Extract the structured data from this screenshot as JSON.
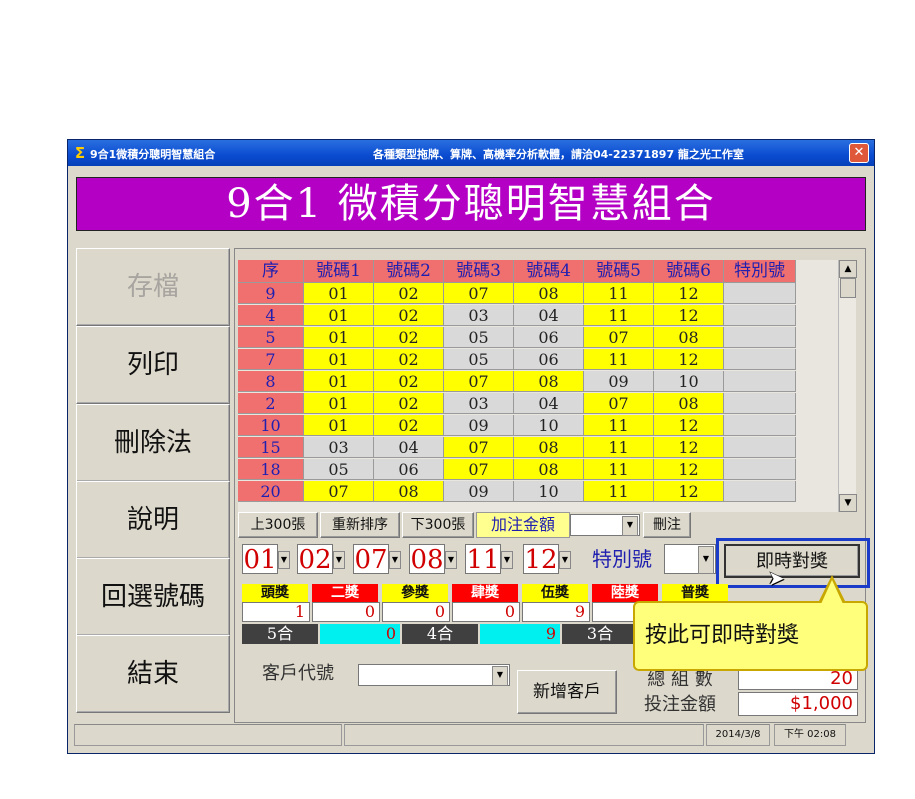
{
  "window": {
    "title": "9合1微積分聰明智慧組合",
    "subtitle": "各種類型拖牌、算牌、高機率分析軟體，請洽04-22371897 龍之光工作室",
    "close_icon": "close-icon",
    "app_icon": "sigma-icon"
  },
  "banner": "9合1 微積分聰明智慧組合",
  "sidebar": [
    {
      "label": "存檔",
      "disabled": true
    },
    {
      "label": "列印",
      "disabled": false
    },
    {
      "label": "刪除法",
      "disabled": false
    },
    {
      "label": "說明",
      "disabled": false
    },
    {
      "label": "回選號碼",
      "disabled": false
    },
    {
      "label": "結束",
      "disabled": false
    }
  ],
  "table": {
    "headers": [
      "序",
      "號碼1",
      "號碼2",
      "號碼3",
      "號碼4",
      "號碼5",
      "號碼6",
      "特別號"
    ],
    "rows": [
      {
        "idx": "9",
        "nums": [
          "01",
          "02",
          "07",
          "08",
          "11",
          "12"
        ],
        "hl": [
          1,
          1,
          1,
          1,
          1,
          1
        ]
      },
      {
        "idx": "4",
        "nums": [
          "01",
          "02",
          "03",
          "04",
          "11",
          "12"
        ],
        "hl": [
          1,
          1,
          0,
          0,
          1,
          1
        ]
      },
      {
        "idx": "5",
        "nums": [
          "01",
          "02",
          "05",
          "06",
          "07",
          "08"
        ],
        "hl": [
          1,
          1,
          0,
          0,
          1,
          1
        ]
      },
      {
        "idx": "7",
        "nums": [
          "01",
          "02",
          "05",
          "06",
          "11",
          "12"
        ],
        "hl": [
          1,
          1,
          0,
          0,
          1,
          1
        ]
      },
      {
        "idx": "8",
        "nums": [
          "01",
          "02",
          "07",
          "08",
          "09",
          "10"
        ],
        "hl": [
          1,
          1,
          1,
          1,
          0,
          0
        ]
      },
      {
        "idx": "2",
        "nums": [
          "01",
          "02",
          "03",
          "04",
          "07",
          "08"
        ],
        "hl": [
          1,
          1,
          0,
          0,
          1,
          1
        ]
      },
      {
        "idx": "10",
        "nums": [
          "01",
          "02",
          "09",
          "10",
          "11",
          "12"
        ],
        "hl": [
          1,
          1,
          0,
          0,
          1,
          1
        ]
      },
      {
        "idx": "15",
        "nums": [
          "03",
          "04",
          "07",
          "08",
          "11",
          "12"
        ],
        "hl": [
          0,
          0,
          1,
          1,
          1,
          1
        ]
      },
      {
        "idx": "18",
        "nums": [
          "05",
          "06",
          "07",
          "08",
          "11",
          "12"
        ],
        "hl": [
          0,
          0,
          1,
          1,
          1,
          1
        ]
      },
      {
        "idx": "20",
        "nums": [
          "07",
          "08",
          "09",
          "10",
          "11",
          "12"
        ],
        "hl": [
          1,
          1,
          0,
          0,
          1,
          1
        ]
      }
    ]
  },
  "toolbar": {
    "prev300": "上300張",
    "resort": "重新排序",
    "next300": "下300張",
    "add_bet_label": "加注金額",
    "delete": "刪注"
  },
  "draw_numbers": [
    "01",
    "02",
    "07",
    "08",
    "11",
    "12"
  ],
  "special_label": "特別號",
  "check_button": "即時對獎",
  "prizes": [
    {
      "name": "頭獎",
      "count": "1",
      "bg": "#ffff00",
      "fg": "#111111"
    },
    {
      "name": "二獎",
      "count": "0",
      "bg": "#ff0000",
      "fg": "#ffffff"
    },
    {
      "name": "參獎",
      "count": "0",
      "bg": "#ffff00",
      "fg": "#111111"
    },
    {
      "name": "肆獎",
      "count": "0",
      "bg": "#ff0000",
      "fg": "#ffffff"
    },
    {
      "name": "伍獎",
      "count": "9",
      "bg": "#ffff00",
      "fg": "#111111"
    },
    {
      "name": "陸獎",
      "count": "",
      "bg": "#ff0000",
      "fg": "#ffffff"
    },
    {
      "name": "普獎",
      "count": "",
      "bg": "#ffff00",
      "fg": "#111111"
    }
  ],
  "hits": [
    {
      "label": "5合",
      "count": "0"
    },
    {
      "label": "4合",
      "count": "9"
    },
    {
      "label": "3合",
      "count": ""
    }
  ],
  "customer_label": "客戶代號",
  "add_customer": "新增客戶",
  "total_groups_label": "總 組 數",
  "total_groups_value": "20",
  "bet_amount_label": "投注金額",
  "bet_amount_value": "$1,000",
  "status": {
    "date": "2014/3/8",
    "time": "下午 02:08"
  },
  "tooltip": "按此可即時對獎",
  "colors": {
    "banner": "#b400c4",
    "header": "#f07070",
    "highlight": "#ffff00",
    "cyan": "#00f0f0"
  }
}
